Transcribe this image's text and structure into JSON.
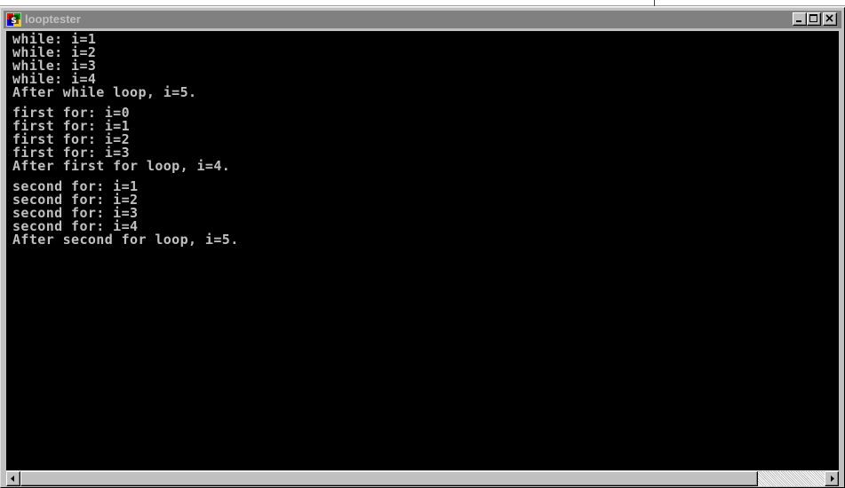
{
  "window": {
    "title": "looptester",
    "icon": "ms-dos-icon",
    "controls": {
      "minimize": "minimize-icon",
      "maximize": "maximize-icon",
      "close": "close-icon"
    }
  },
  "console": {
    "lines": [
      "while: i=1",
      "while: i=2",
      "while: i=3",
      "while: i=4",
      "After while loop, i=5.",
      "",
      "first for: i=0",
      "first for: i=1",
      "first for: i=2",
      "first for: i=3",
      "After first for loop, i=4.",
      "",
      "second for: i=1",
      "second for: i=2",
      "second for: i=3",
      "second for: i=4",
      "After second for loop, i=5."
    ]
  },
  "scrollbar": {
    "left_icon": "arrow-left-icon",
    "right_icon": "arrow-right-icon"
  },
  "colors": {
    "console_background": "#000000",
    "console_text": "#c0c0c0",
    "titlebar_inactive": "#808080",
    "titlebar_text": "#c0c0c0",
    "window_face": "#c0c0c0"
  }
}
